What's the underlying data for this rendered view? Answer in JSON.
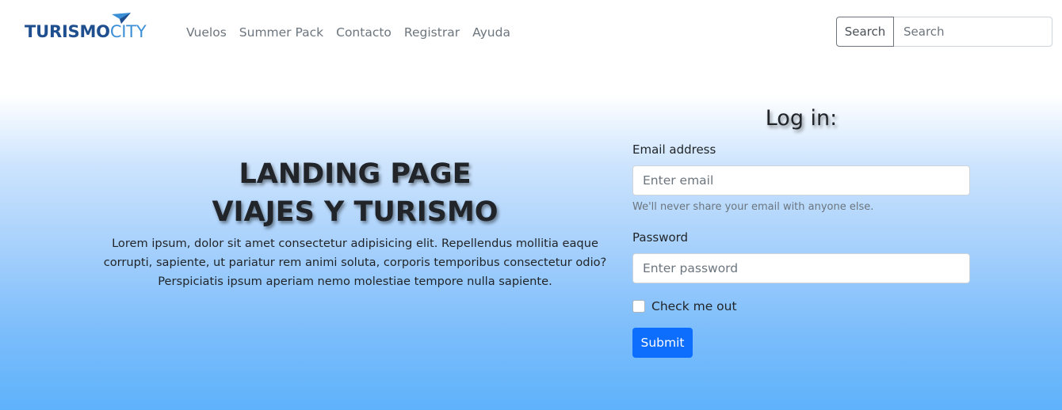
{
  "brand": {
    "part1": "TURISMO",
    "part2": "CITY",
    "colors": {
      "primary": "#1f4f8f",
      "secondary": "#3b8fd6"
    }
  },
  "nav": {
    "links": [
      "Vuelos",
      "Summer Pack",
      "Contacto",
      "Registrar",
      "Ayuda"
    ]
  },
  "search": {
    "button_label": "Search",
    "placeholder": "Search"
  },
  "hero": {
    "title_line1": "LANDING PAGE",
    "title_line2": "VIAJES Y TURISMO",
    "text": "Lorem ipsum, dolor sit amet consectetur adipisicing elit. Repellendus mollitia eaque corrupti, sapiente, ut pariatur rem animi soluta, corporis temporibus consectetur odio? Perspiciatis ipsum aperiam nemo molestiae tempore nulla sapiente."
  },
  "login": {
    "title": "Log in:",
    "email_label": "Email address",
    "email_placeholder": "Enter email",
    "email_help": "We'll never share your email with anyone else.",
    "password_label": "Password",
    "password_placeholder": "Enter password",
    "check_label": "Check me out",
    "submit_label": "Submit"
  },
  "colors": {
    "primary_button": "#0d6efd",
    "hero_gradient_bottom": "#5eb2fb"
  }
}
